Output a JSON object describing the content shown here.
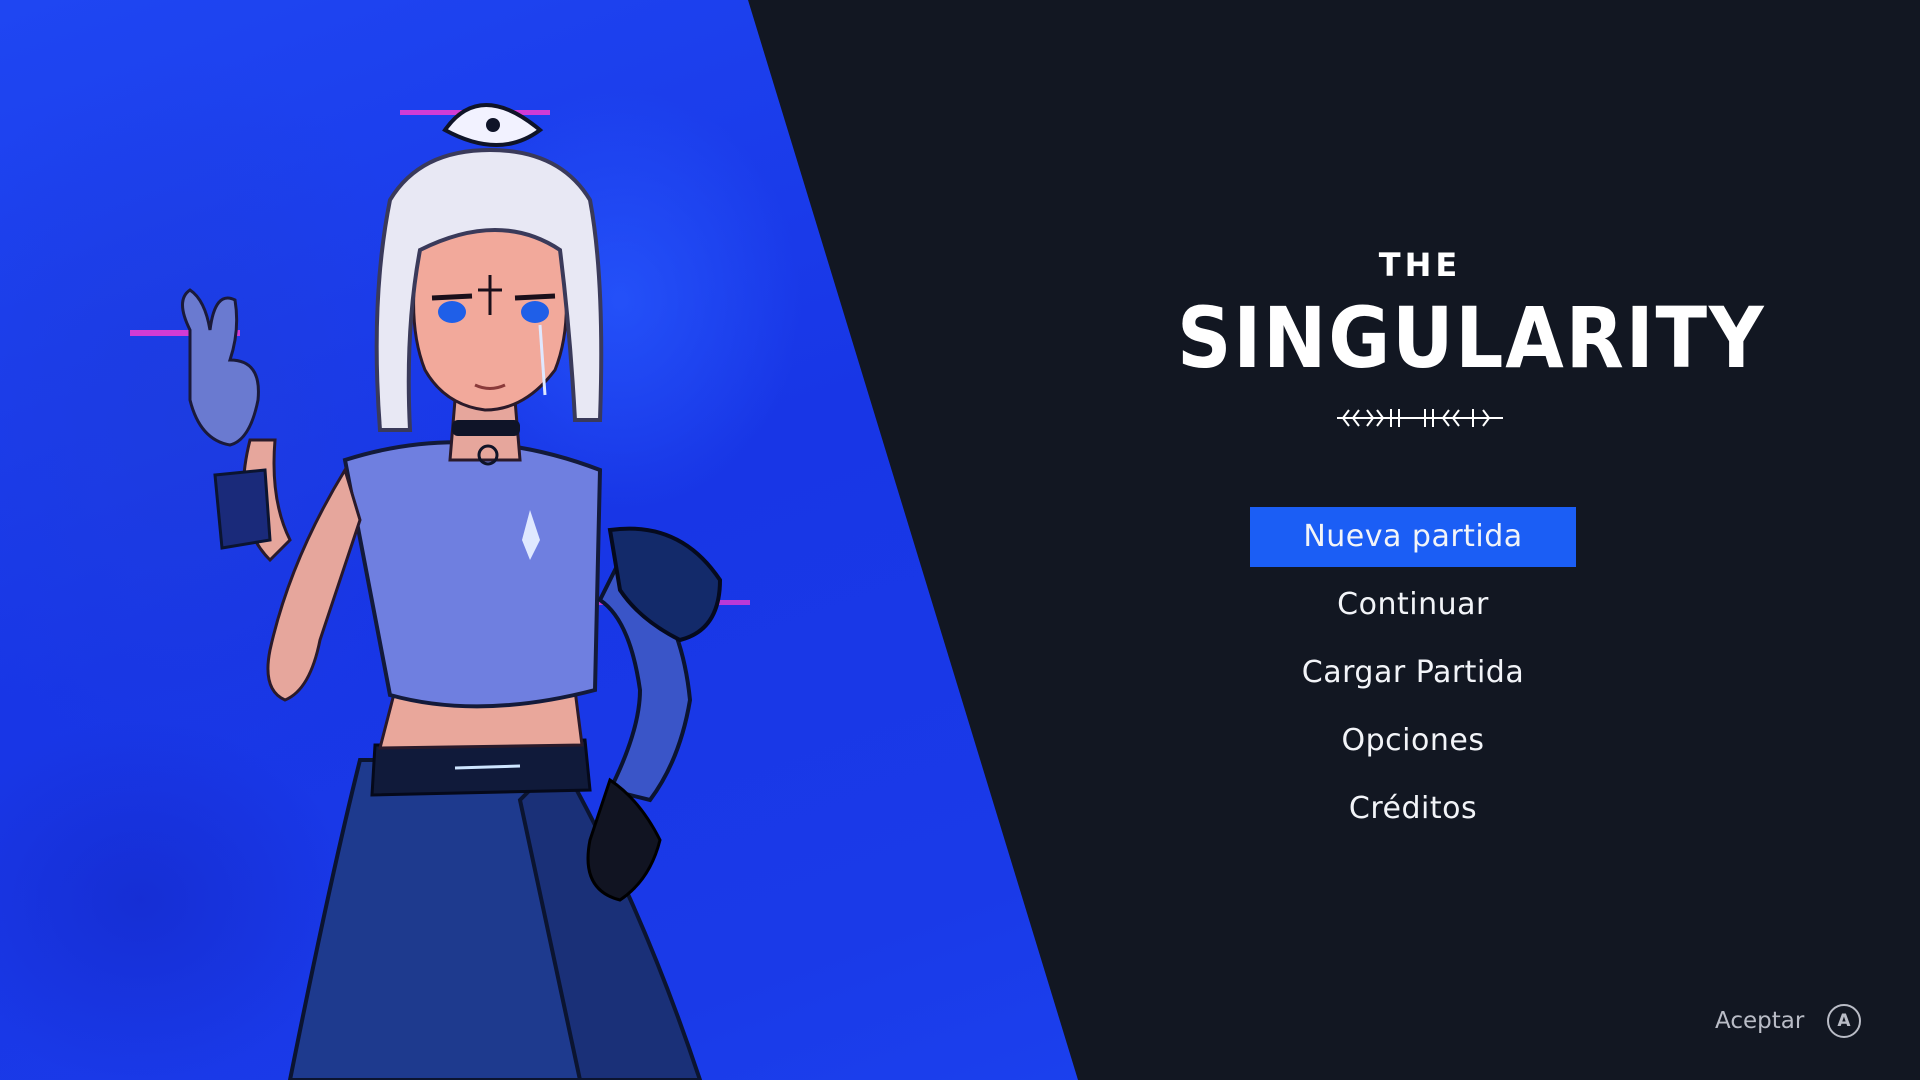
{
  "game": {
    "title_prefix": "THE",
    "title": "SINGULARITY"
  },
  "menu": {
    "items": [
      {
        "label": "Nueva partida",
        "selected": true
      },
      {
        "label": "Continuar",
        "selected": false
      },
      {
        "label": "Cargar Partida",
        "selected": false
      },
      {
        "label": "Opciones",
        "selected": false
      },
      {
        "label": "Créditos",
        "selected": false
      }
    ]
  },
  "hint": {
    "label": "Aceptar",
    "button": "A"
  },
  "colors": {
    "background": "#121722",
    "art_panel_blue": "#1a3ae8",
    "selection": "#1b5ef5",
    "menu_text": "#f2f4f8",
    "hint_text": "#b9bcc6"
  }
}
